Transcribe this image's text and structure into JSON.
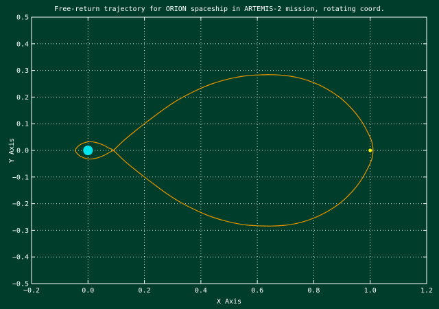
{
  "chart_data": {
    "type": "line",
    "title": "Free-return trajectory for ORION spaceship in ARTEMIS-2 mission, rotating coord.",
    "xlabel": "X Axis",
    "ylabel": "Y Axis",
    "xlim": [
      -0.2,
      1.2
    ],
    "ylim": [
      -0.5,
      0.5
    ],
    "xticks": [
      -0.2,
      0.0,
      0.2,
      0.4,
      0.6,
      0.8,
      1.0,
      1.2
    ],
    "xtick_labels": [
      "−0.2",
      "0.0",
      "0.2",
      "0.4",
      "0.6",
      "0.8",
      "1.0",
      "1.2"
    ],
    "yticks": [
      0.5,
      0.4,
      0.3,
      0.2,
      0.1,
      0.0,
      -0.1,
      -0.2,
      -0.3,
      -0.4,
      -0.5
    ],
    "ytick_labels": [
      "0.5",
      "0.4",
      "0.3",
      "0.2",
      "0.1",
      "0.0",
      "−0.1",
      "−0.2",
      "−0.3",
      "−0.4",
      "−0.5"
    ],
    "grid": true,
    "colors": {
      "background": "#003d2b",
      "trajectory": "#e69500",
      "earth": "#00e5ee",
      "moon": "#ffff00",
      "text": "#ffffff"
    },
    "series": [
      {
        "x": [
          0.09,
          0.13,
          0.17,
          0.2,
          0.24,
          0.28,
          0.32,
          0.36,
          0.4,
          0.44,
          0.48,
          0.52,
          0.56,
          0.6,
          0.65,
          0.7,
          0.74,
          0.78,
          0.82,
          0.86,
          0.9,
          0.94,
          0.97,
          0.99,
          1.005,
          1.01,
          1.005,
          0.99,
          0.97,
          0.94,
          0.9,
          0.86,
          0.82,
          0.78,
          0.74,
          0.7,
          0.65,
          0.6,
          0.56,
          0.52,
          0.48,
          0.44,
          0.4,
          0.36,
          0.32,
          0.28,
          0.24,
          0.2,
          0.17,
          0.13,
          0.09,
          0.075,
          0.06,
          0.045,
          0.03,
          0.015,
          0.0,
          -0.015,
          -0.03,
          -0.04,
          -0.045,
          -0.04,
          -0.03,
          -0.015,
          0.0,
          0.015,
          0.03,
          0.045,
          0.06,
          0.075,
          0.09
        ],
        "y": [
          0.0,
          0.04,
          0.075,
          0.1,
          0.132,
          0.163,
          0.19,
          0.213,
          0.233,
          0.25,
          0.263,
          0.273,
          0.28,
          0.283,
          0.284,
          0.281,
          0.274,
          0.262,
          0.245,
          0.222,
          0.192,
          0.15,
          0.108,
          0.07,
          0.035,
          0.0,
          -0.035,
          -0.07,
          -0.108,
          -0.15,
          -0.192,
          -0.222,
          -0.245,
          -0.262,
          -0.274,
          -0.281,
          -0.284,
          -0.283,
          -0.28,
          -0.273,
          -0.263,
          -0.25,
          -0.233,
          -0.213,
          -0.19,
          -0.163,
          -0.132,
          -0.1,
          -0.075,
          -0.04,
          0.0,
          0.008,
          0.017,
          0.024,
          0.029,
          0.032,
          0.032,
          0.028,
          0.02,
          0.01,
          0.0,
          -0.01,
          -0.02,
          -0.028,
          -0.032,
          -0.032,
          -0.029,
          -0.024,
          -0.017,
          -0.008,
          0.0
        ]
      }
    ],
    "markers": [
      {
        "x": 0.0,
        "y": 0.0
      },
      {
        "x": 1.0,
        "y": 0.0
      }
    ]
  }
}
